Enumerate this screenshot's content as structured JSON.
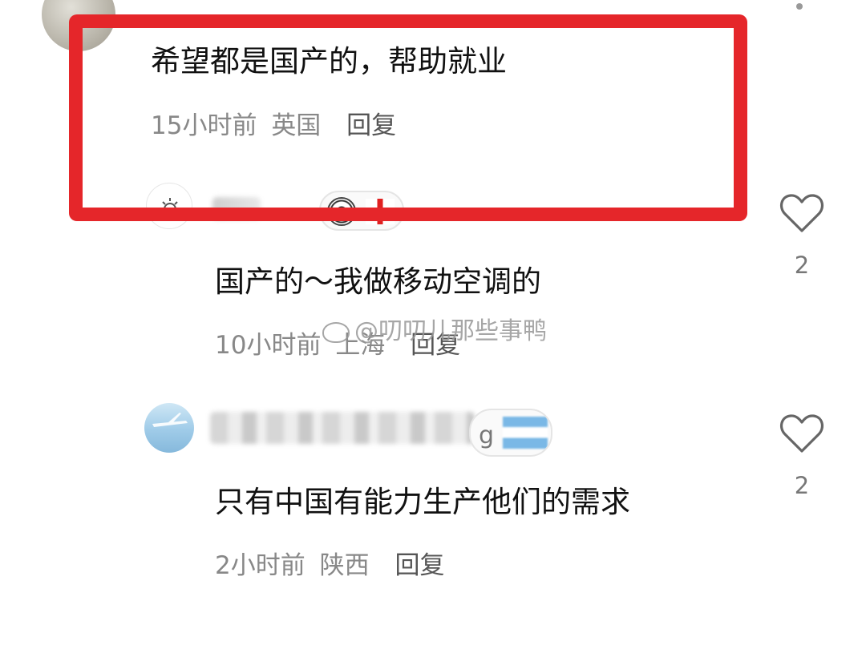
{
  "comments": [
    {
      "text": "希望都是国产的，帮助就业",
      "time": "15小时前",
      "location": "英国",
      "reply_label": "回复"
    },
    {
      "text": "国产的～我做移动空调的",
      "time": "10小时前",
      "location": "上海",
      "reply_label": "回复",
      "likes": "2"
    },
    {
      "text": "只有中国有能力生产他们的需求",
      "time": "2小时前",
      "location": "陕西",
      "reply_label": "回复",
      "likes": "2"
    }
  ],
  "watermark": "@叨叨儿那些事鸭",
  "colors": {
    "highlight": "#e5262a",
    "text": "#111111",
    "meta": "#888888"
  },
  "icons": {
    "like": "heart-outline-icon",
    "watermark": "weibo-icon"
  }
}
